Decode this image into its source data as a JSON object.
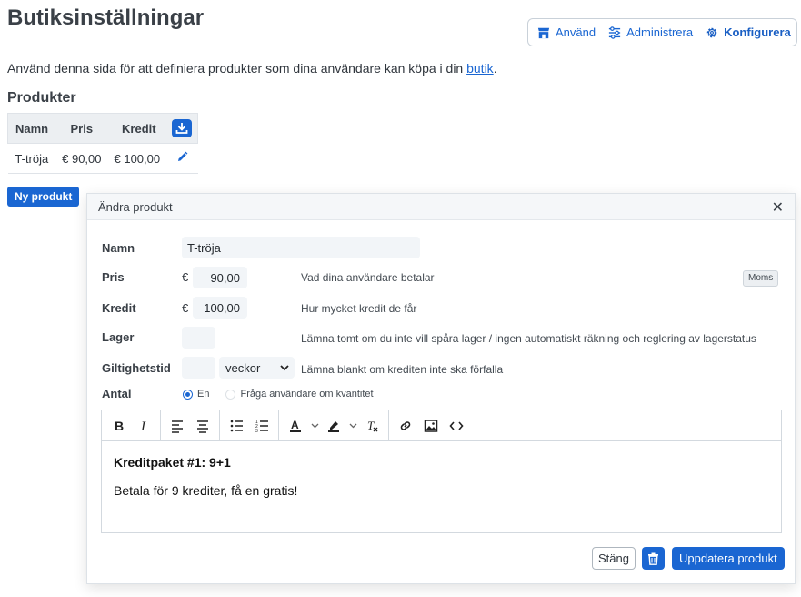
{
  "page": {
    "title": "Butiksinställningar",
    "intro_text": "Använd denna sida för att definiera produkter som dina användare kan köpa i din ",
    "intro_link": "butik",
    "intro_end": "."
  },
  "topnav": {
    "items": [
      {
        "label": "Använd",
        "icon": "store-icon"
      },
      {
        "label": "Administrera",
        "icon": "sliders-icon"
      },
      {
        "label": "Konfigurera",
        "icon": "gear-icon",
        "active": true
      }
    ]
  },
  "products": {
    "title": "Produkter",
    "columns": [
      "Namn",
      "Pris",
      "Kredit"
    ],
    "rows": [
      {
        "name": "T-tröja",
        "price": "€ 90,00",
        "credit": "€ 100,00"
      }
    ],
    "new_button": "Ny produkt"
  },
  "modal": {
    "title": "Ändra produkt",
    "close_symbol": "✕",
    "fields": {
      "name": {
        "label": "Namn",
        "value": "T-tröja"
      },
      "price": {
        "label": "Pris",
        "currency": "€",
        "value": "90,00",
        "help": "Vad dina användare betalar",
        "vat_button": "Moms"
      },
      "credit": {
        "label": "Kredit",
        "currency": "€",
        "value": "100,00",
        "help": "Hur mycket kredit de får"
      },
      "stock": {
        "label": "Lager",
        "value": "",
        "help": "Lämna tomt om du inte vill spåra lager / ingen automatiskt räkning och reglering av lagerstatus"
      },
      "validity": {
        "label": "Giltighetstid",
        "value": "",
        "unit": "veckor",
        "help": "Lämna blankt om krediten inte ska förfalla"
      },
      "quantity": {
        "label": "Antal",
        "options": [
          "En",
          "Fråga användare om kvantitet"
        ],
        "selected": 0
      }
    },
    "editor": {
      "heading": "Kreditpaket #1: 9+1",
      "paragraph": "Betala för 9 krediter, få en gratis!"
    },
    "buttons": {
      "close": "Stäng",
      "update": "Uppdatera produkt"
    }
  },
  "colors": {
    "accent": "#1a66d2",
    "text": "#3a4047"
  }
}
